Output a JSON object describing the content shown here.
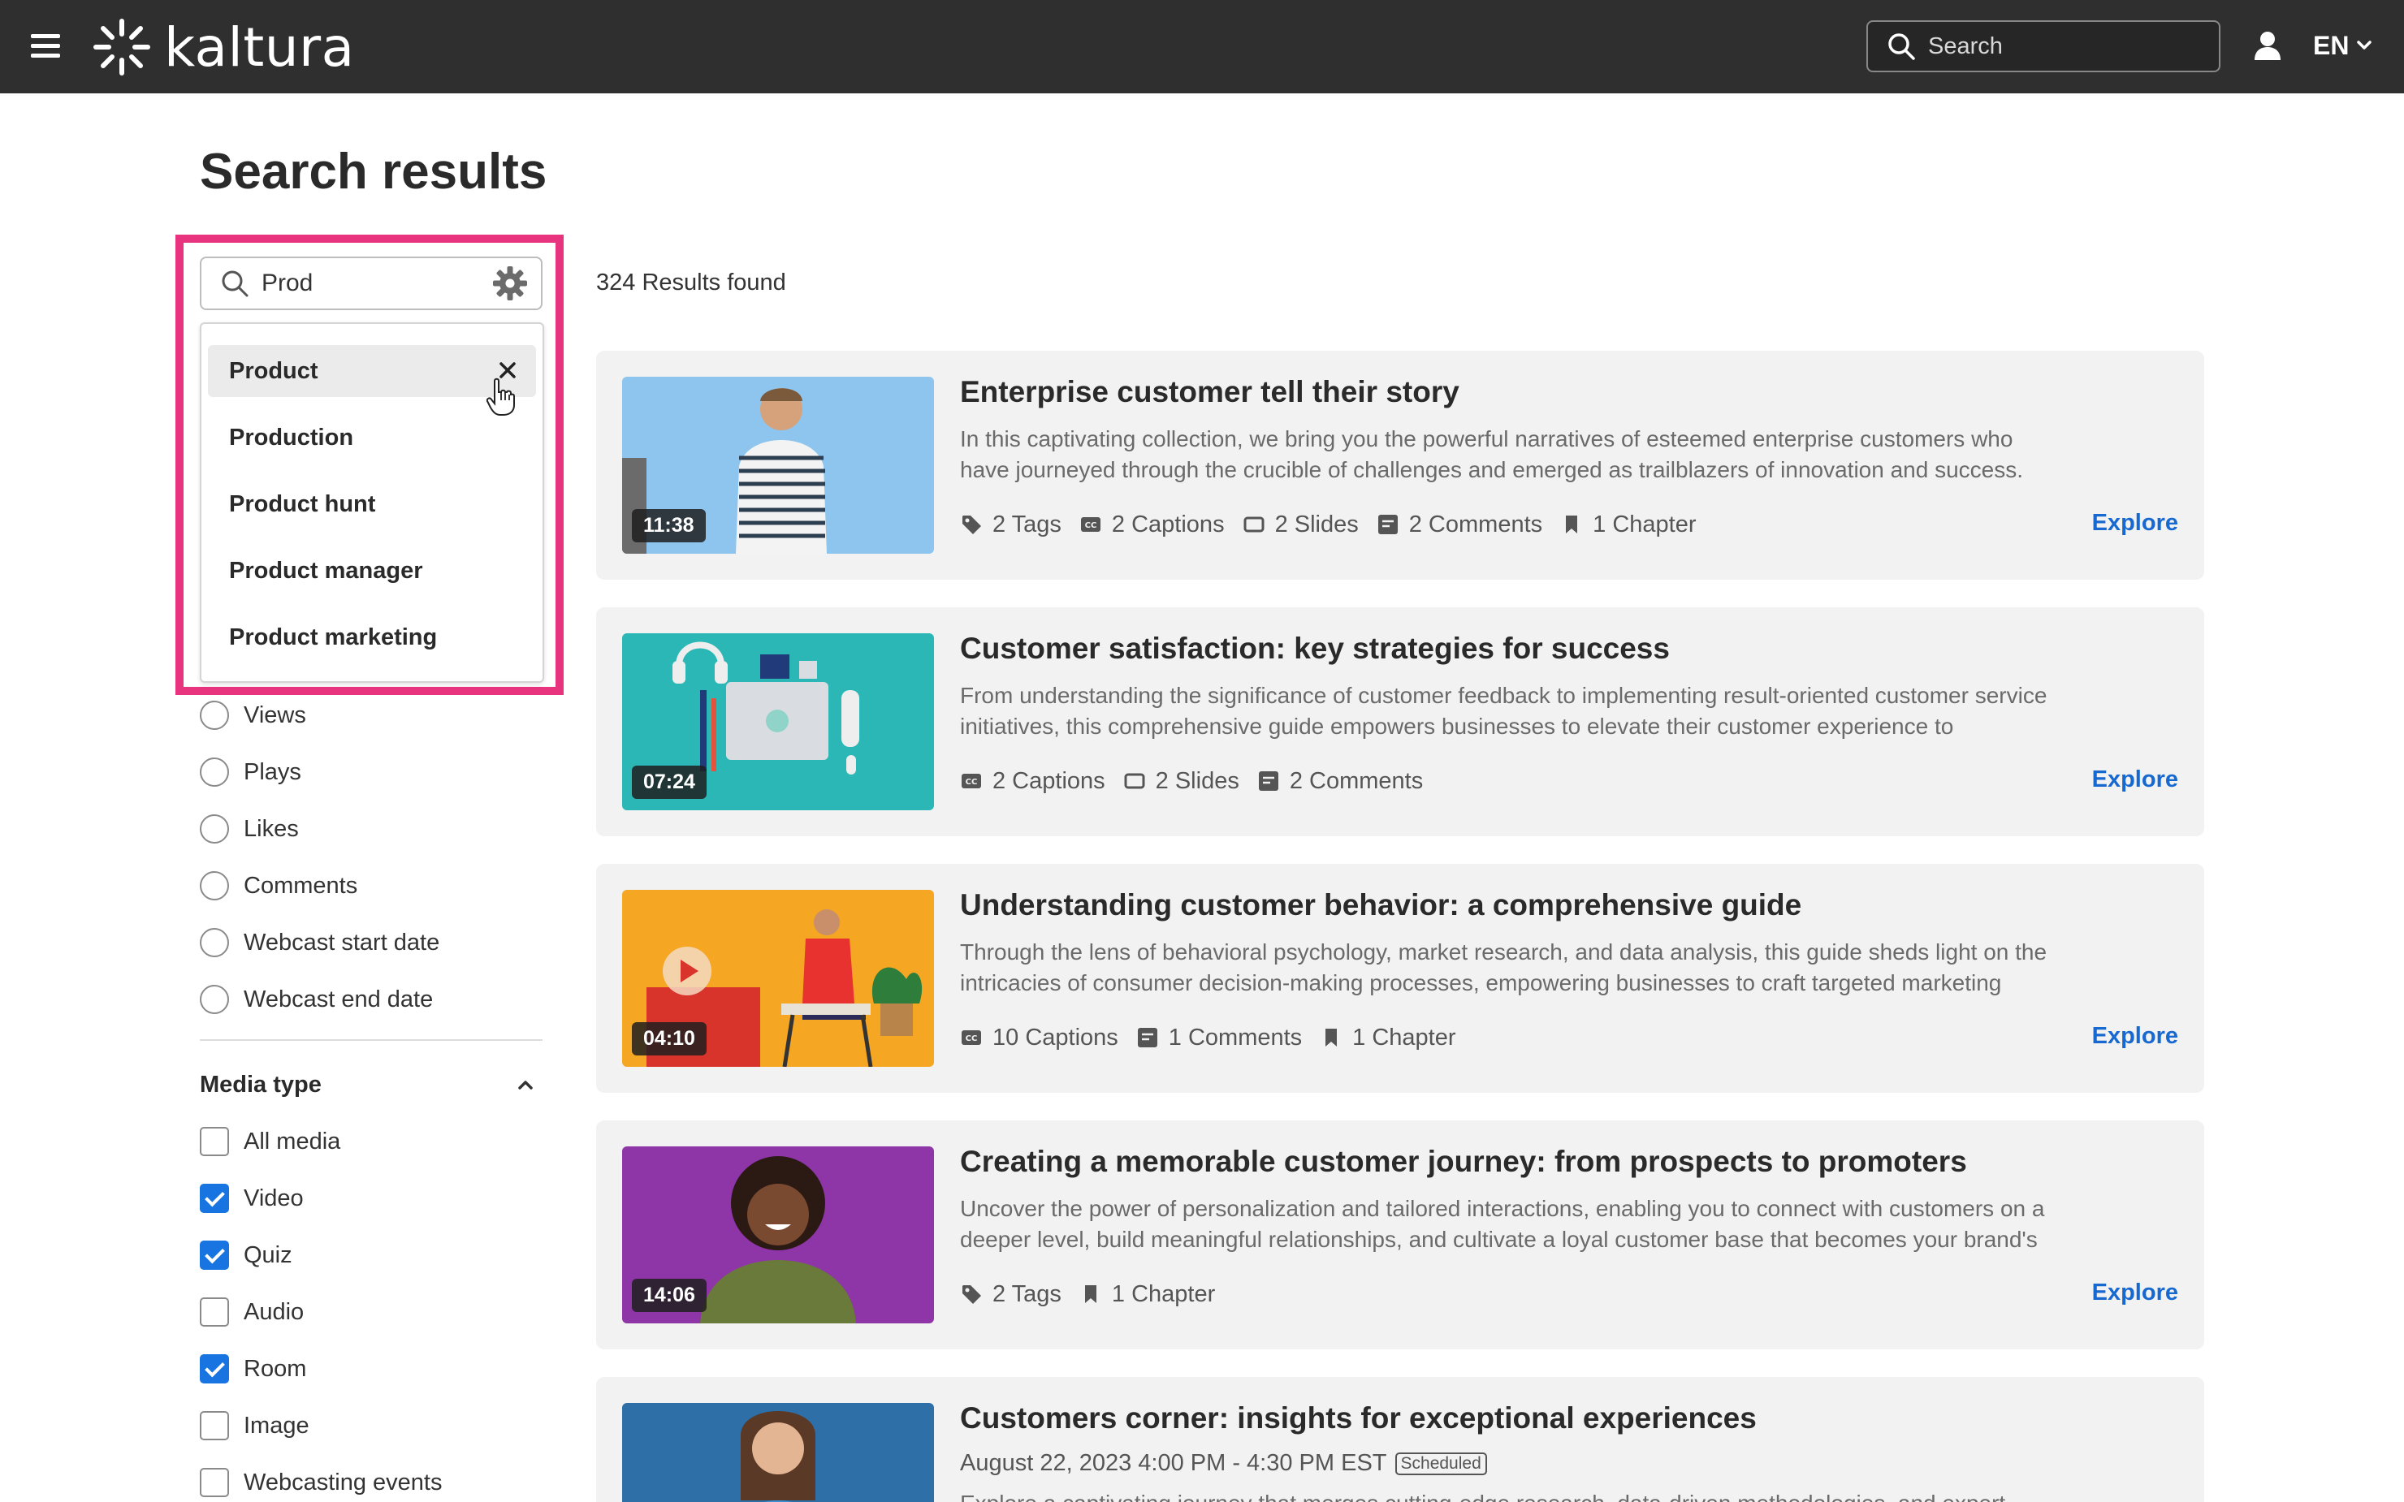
{
  "header": {
    "logo_text": "kaltura",
    "search_placeholder": "Search",
    "language": "EN"
  },
  "page_title": "Search results",
  "filter": {
    "search_value": "Prod",
    "suggestions": [
      "Product",
      "Production",
      "Product hunt",
      "Product manager",
      "Product marketing"
    ]
  },
  "sort_options": [
    "Views",
    "Plays",
    "Likes",
    "Comments",
    "Webcast start date",
    "Webcast end date"
  ],
  "media_type": {
    "title": "Media type",
    "options": [
      {
        "label": "All media",
        "checked": false
      },
      {
        "label": "Video",
        "checked": true
      },
      {
        "label": "Quiz",
        "checked": true
      },
      {
        "label": "Audio",
        "checked": false
      },
      {
        "label": "Room",
        "checked": true
      },
      {
        "label": "Image",
        "checked": false
      },
      {
        "label": "Webcasting events",
        "checked": false
      }
    ]
  },
  "results": {
    "count_text": "324 Results found",
    "explore_label": "Explore",
    "items": [
      {
        "title": "Enterprise customer tell their story",
        "description": "In this captivating collection, we bring you the powerful narratives of esteemed enterprise customers who have journeyed through the crucible of challenges and emerged as trailblazers of innovation and success.",
        "duration": "11:38",
        "meta": [
          "2 Tags",
          "2 Captions",
          "2 Slides",
          "2 Comments",
          "1 Chapter"
        ]
      },
      {
        "title": "Customer satisfaction: key strategies for success",
        "description": "From understanding the significance of customer feedback to implementing result-oriented customer service initiatives, this comprehensive guide empowers businesses to elevate their customer experience to",
        "duration": "07:24",
        "meta": [
          "2 Captions",
          "2 Slides",
          "2 Comments"
        ]
      },
      {
        "title": "Understanding customer behavior: a comprehensive guide",
        "description": "Through the lens of behavioral psychology, market research, and data analysis, this guide sheds light on the intricacies of consumer decision-making processes, empowering businesses to craft targeted marketing",
        "duration": "04:10",
        "meta": [
          "10 Captions",
          "1 Comments",
          "1 Chapter"
        ]
      },
      {
        "title": "Creating a memorable customer journey: from prospects to promoters",
        "description": "Uncover the power of personalization and tailored interactions, enabling you to connect with customers on a deeper level, build meaningful relationships, and cultivate a loyal customer base that becomes your brand's",
        "duration": "14:06",
        "meta": [
          "2 Tags",
          "1 Chapter"
        ]
      },
      {
        "title": "Customers corner: insights for exceptional experiences",
        "date": "August 22, 2023 4:00 PM - 4:30 PM EST",
        "status": "Scheduled",
        "description": "Explore a captivating journey that merges cutting-edge research, data-driven methodologies, and expert"
      }
    ]
  },
  "colors": {
    "topbar": "#2f2f2f",
    "highlight": "#e8337f",
    "accent": "#1774e0",
    "link": "#1769d0",
    "card_bg": "#f2f2f2"
  }
}
